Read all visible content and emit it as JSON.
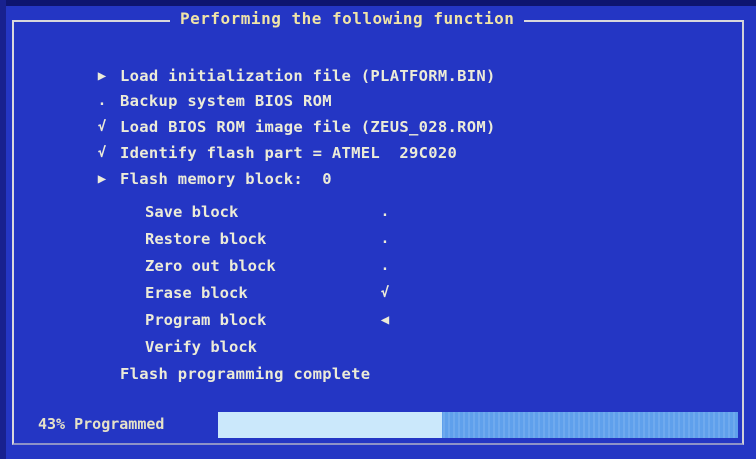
{
  "frame": {
    "title": "Performing the following function"
  },
  "steps": [
    {
      "marker": "▶",
      "marker_icon": "arrow-right-icon",
      "text": "Load initialization file (PLATFORM.BIN)"
    },
    {
      "marker": ".",
      "marker_icon": "dot-icon",
      "text": "Backup system BIOS ROM"
    },
    {
      "marker": "√",
      "marker_icon": "checkmark-icon",
      "text": "Load BIOS ROM image file (ZEUS_028.ROM)"
    },
    {
      "marker": "√",
      "marker_icon": "checkmark-icon",
      "text": "Identify flash part = ATMEL  29C020"
    },
    {
      "marker": "▶",
      "marker_icon": "arrow-right-icon",
      "text": "Flash memory block:  0"
    }
  ],
  "block_ops": [
    {
      "label": "Save block",
      "status": ".",
      "status_icon": "dot-icon"
    },
    {
      "label": "Restore block",
      "status": ".",
      "status_icon": "dot-icon"
    },
    {
      "label": "Zero out block",
      "status": ".",
      "status_icon": "dot-icon"
    },
    {
      "label": "Erase block",
      "status": "√",
      "status_icon": "checkmark-icon"
    },
    {
      "label": "Program block",
      "status": "◀",
      "status_icon": "arrow-left-icon"
    },
    {
      "label": "Verify block",
      "status": "",
      "status_icon": ""
    }
  ],
  "completion_message": "Flash programming complete",
  "progress": {
    "label": "43% Programmed",
    "percent": 43,
    "colors": {
      "fill": "#cbe8fb",
      "track": "#5fa0ec"
    }
  },
  "colors": {
    "background": "#2436c4",
    "text": "#ecebd8",
    "title": "#f0e4a8"
  }
}
